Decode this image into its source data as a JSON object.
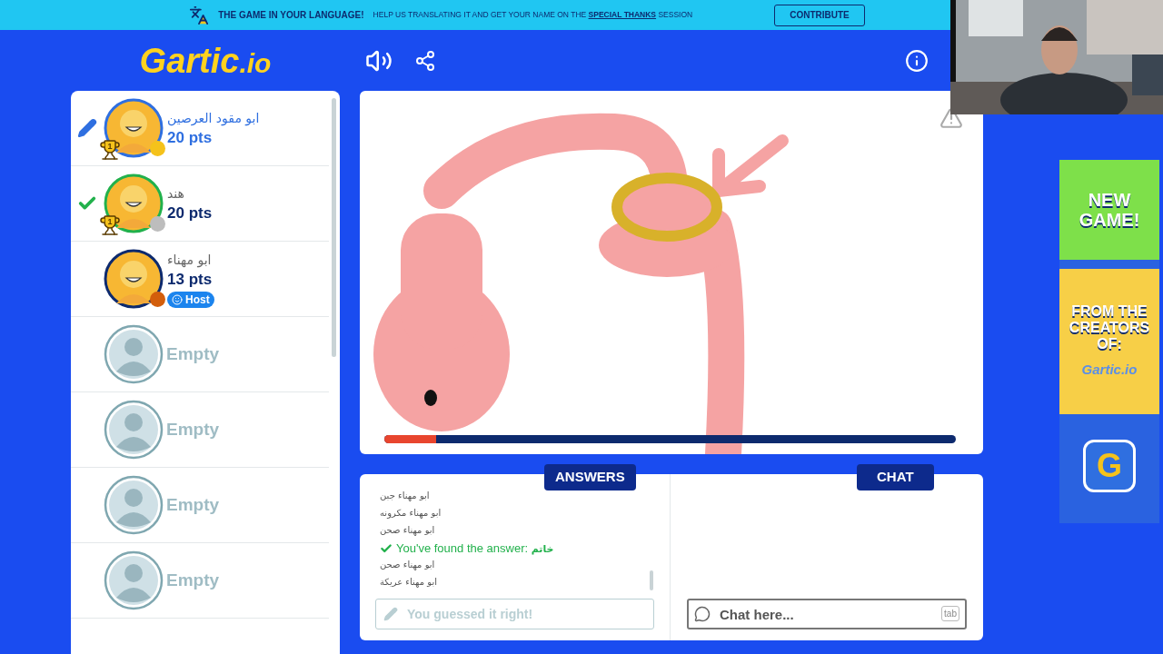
{
  "banner": {
    "headline": "THE GAME IN YOUR LANGUAGE!",
    "text_before": "HELP US TRANSLATING IT AND GET YOUR NAME ON THE",
    "link": "SPECIAL THANKS",
    "text_after": "SESSION",
    "button": "CONTRIBUTE"
  },
  "logo": {
    "main": "Gartic",
    "suffix": ".io"
  },
  "players": [
    {
      "kind": "player",
      "name": "ابو مقود العرصين",
      "points": "20 pts",
      "drawing": true,
      "guessed": false,
      "trophy": "1",
      "color": "#f5c21b",
      "highlight": true
    },
    {
      "kind": "player",
      "name": "هند",
      "points": "20 pts",
      "drawing": false,
      "guessed": true,
      "trophy": "1",
      "color": "#bdbdbd",
      "highlight": false
    },
    {
      "kind": "player",
      "name": "ابو مهناء",
      "points": "13 pts",
      "drawing": false,
      "guessed": false,
      "color": "#d35e0c",
      "highlight": false,
      "badge": "Host"
    },
    {
      "kind": "empty",
      "name": "Empty"
    },
    {
      "kind": "empty",
      "name": "Empty"
    },
    {
      "kind": "empty",
      "name": "Empty"
    },
    {
      "kind": "empty",
      "name": "Empty"
    }
  ],
  "canvas": {
    "timer": {
      "level": 0.09
    }
  },
  "answers": {
    "title": "ANSWERS",
    "lines": [
      {
        "kind": "guess",
        "text": "ابو مهناء جبن"
      },
      {
        "kind": "guess",
        "text": "ابو مهناء مكرونه"
      },
      {
        "kind": "guess",
        "text": "ابو مهناء صحن"
      },
      {
        "kind": "found",
        "text": "You've found the answer:",
        "answer": "خاتم"
      },
      {
        "kind": "guess",
        "text": "ابو مهناء صحن"
      },
      {
        "kind": "guess",
        "text": "ابو مهناء عريكة"
      }
    ],
    "input": {
      "placeholder": "You guessed it right!",
      "disabled": true
    }
  },
  "chat": {
    "title": "CHAT",
    "input": {
      "placeholder": "Chat here..."
    },
    "key_hint": "tab"
  },
  "ad": {
    "headline": "NEW GAME!",
    "subline": "FROM THE CREATORS OF:",
    "logo": "Gartic.io",
    "app_letter": "G"
  }
}
